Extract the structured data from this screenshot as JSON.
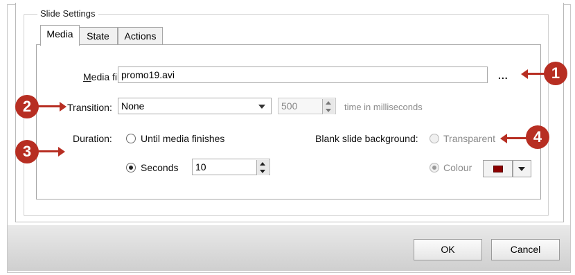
{
  "group": {
    "title": "Slide Settings"
  },
  "tabs": [
    {
      "label": "Media",
      "active": true
    },
    {
      "label": "State",
      "active": false
    },
    {
      "label": "Actions",
      "active": false
    }
  ],
  "media_file": {
    "label": "Media file:",
    "value": "promo19.avi",
    "browse": "..."
  },
  "transition": {
    "label": "Transition:",
    "value": "None",
    "time_value": "500",
    "time_unit": "time in milliseconds"
  },
  "duration": {
    "label": "Duration:",
    "until_label": "Until media finishes",
    "until_selected": false,
    "seconds_label": "Seconds",
    "seconds_selected": true,
    "seconds_value": "10"
  },
  "background": {
    "label": "Blank slide background:",
    "transparent_label": "Transparent",
    "transparent_selected": false,
    "colour_label": "Colour",
    "colour_selected": true,
    "colour_value": "#8b0000"
  },
  "buttons": {
    "ok": "OK",
    "cancel": "Cancel"
  },
  "callouts": [
    "1",
    "2",
    "3",
    "4"
  ],
  "accent_color": "#b72e22"
}
